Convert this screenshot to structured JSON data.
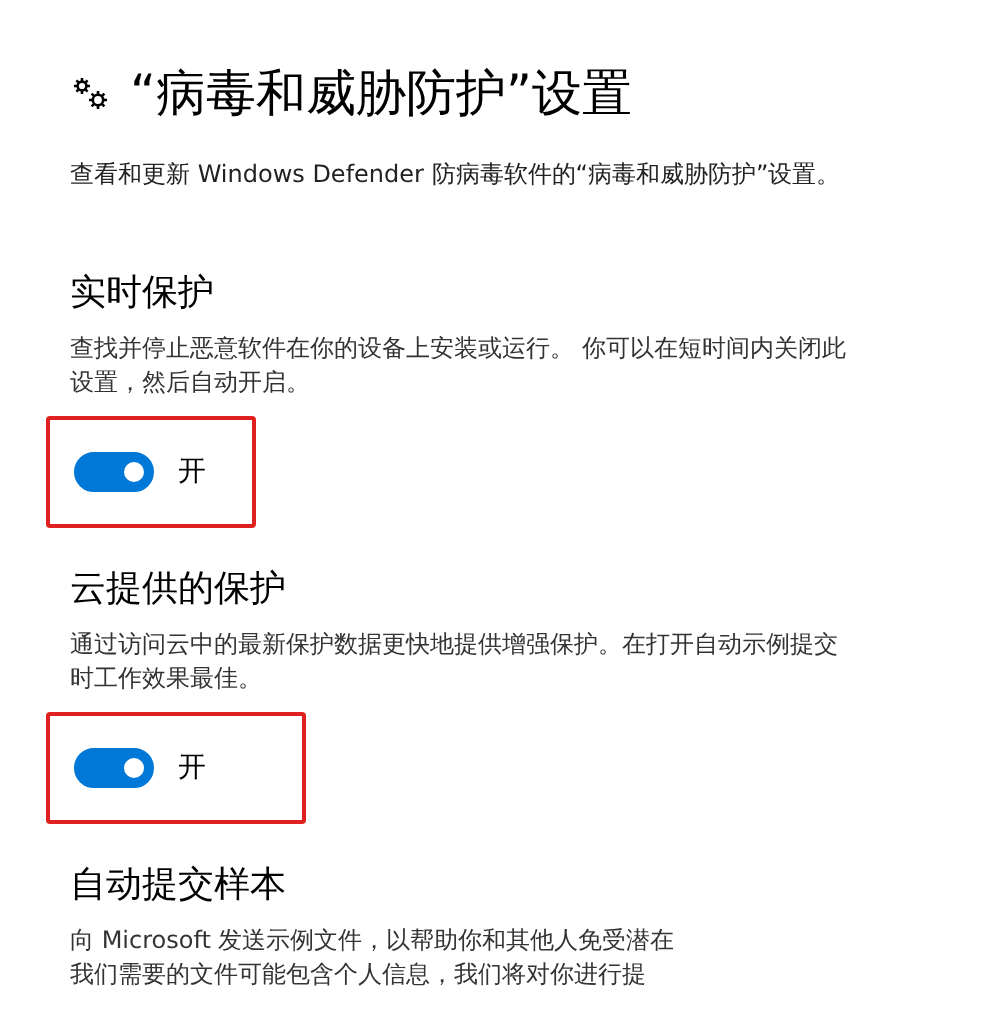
{
  "page": {
    "title": "“病毒和威胁防护”设置",
    "subtitle": "查看和更新 Windows Defender 防病毒软件的“病毒和威胁防护”设置。"
  },
  "sections": [
    {
      "heading": "实时保护",
      "description": [
        "查找并停止恶意软件在你的设备上安装或运行。 你可以在短时间内关闭此",
        "设置，然后自动开启。"
      ],
      "toggle": {
        "on": true,
        "label": "开",
        "highlighted": true
      }
    },
    {
      "heading": "云提供的保护",
      "description": [
        "通过访问云中的最新保护数据更快地提供增强保护。在打开自动示例提交",
        "时工作效果最佳。"
      ],
      "toggle": {
        "on": true,
        "label": "开",
        "highlighted": true
      }
    },
    {
      "heading": "自动提交样本",
      "description": [
        "向 Microsoft 发送示例文件，以帮助你和其他人免受潜在",
        "我们需要的文件可能包含个人信息，我们将对你进行提"
      ]
    }
  ]
}
